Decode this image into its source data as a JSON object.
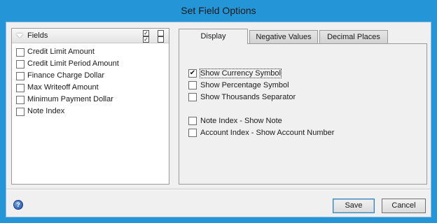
{
  "window": {
    "title": "Set Field Options"
  },
  "fields": {
    "header_label": "Fields",
    "items": [
      {
        "label": "Credit Limit Amount",
        "checked": false
      },
      {
        "label": "Credit Limit Period Amount",
        "checked": false
      },
      {
        "label": "Finance Charge Dollar",
        "checked": false
      },
      {
        "label": "Max Writeoff Amount",
        "checked": false
      },
      {
        "label": "Minimum Payment Dollar",
        "checked": false
      },
      {
        "label": "Note Index",
        "checked": false
      }
    ]
  },
  "tabs": [
    {
      "label": "Display",
      "active": true
    },
    {
      "label": "Negative Values",
      "active": false
    },
    {
      "label": "Decimal Places",
      "active": false
    }
  ],
  "display_options": [
    {
      "label": "Show Currency Symbol",
      "checked": true
    },
    {
      "label": "Show Percentage Symbol",
      "checked": false
    },
    {
      "label": "Show Thousands Separator",
      "checked": false
    },
    {
      "label": "Note Index - Show Note",
      "checked": false
    },
    {
      "label": "Account Index - Show Account Number",
      "checked": false
    }
  ],
  "buttons": {
    "save": "Save",
    "cancel": "Cancel"
  },
  "icons": {
    "help": "help-icon"
  },
  "colors": {
    "titlebar": "#2496d8",
    "panel": "#f0f0f0"
  }
}
